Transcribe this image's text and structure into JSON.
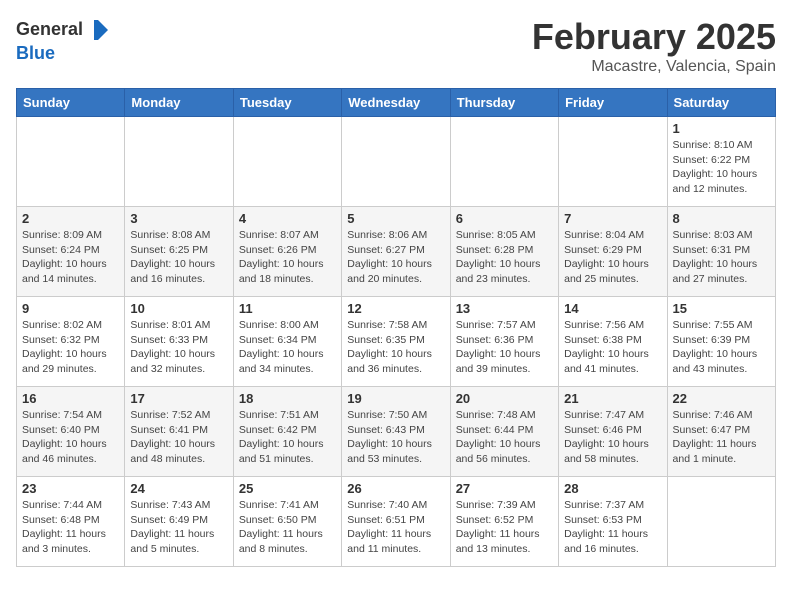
{
  "header": {
    "logo_line1": "General",
    "logo_line2": "Blue",
    "month": "February 2025",
    "location": "Macastre, Valencia, Spain"
  },
  "weekdays": [
    "Sunday",
    "Monday",
    "Tuesday",
    "Wednesday",
    "Thursday",
    "Friday",
    "Saturday"
  ],
  "weeks": [
    [
      {
        "day": "",
        "info": ""
      },
      {
        "day": "",
        "info": ""
      },
      {
        "day": "",
        "info": ""
      },
      {
        "day": "",
        "info": ""
      },
      {
        "day": "",
        "info": ""
      },
      {
        "day": "",
        "info": ""
      },
      {
        "day": "1",
        "info": "Sunrise: 8:10 AM\nSunset: 6:22 PM\nDaylight: 10 hours\nand 12 minutes."
      }
    ],
    [
      {
        "day": "2",
        "info": "Sunrise: 8:09 AM\nSunset: 6:24 PM\nDaylight: 10 hours\nand 14 minutes."
      },
      {
        "day": "3",
        "info": "Sunrise: 8:08 AM\nSunset: 6:25 PM\nDaylight: 10 hours\nand 16 minutes."
      },
      {
        "day": "4",
        "info": "Sunrise: 8:07 AM\nSunset: 6:26 PM\nDaylight: 10 hours\nand 18 minutes."
      },
      {
        "day": "5",
        "info": "Sunrise: 8:06 AM\nSunset: 6:27 PM\nDaylight: 10 hours\nand 20 minutes."
      },
      {
        "day": "6",
        "info": "Sunrise: 8:05 AM\nSunset: 6:28 PM\nDaylight: 10 hours\nand 23 minutes."
      },
      {
        "day": "7",
        "info": "Sunrise: 8:04 AM\nSunset: 6:29 PM\nDaylight: 10 hours\nand 25 minutes."
      },
      {
        "day": "8",
        "info": "Sunrise: 8:03 AM\nSunset: 6:31 PM\nDaylight: 10 hours\nand 27 minutes."
      }
    ],
    [
      {
        "day": "9",
        "info": "Sunrise: 8:02 AM\nSunset: 6:32 PM\nDaylight: 10 hours\nand 29 minutes."
      },
      {
        "day": "10",
        "info": "Sunrise: 8:01 AM\nSunset: 6:33 PM\nDaylight: 10 hours\nand 32 minutes."
      },
      {
        "day": "11",
        "info": "Sunrise: 8:00 AM\nSunset: 6:34 PM\nDaylight: 10 hours\nand 34 minutes."
      },
      {
        "day": "12",
        "info": "Sunrise: 7:58 AM\nSunset: 6:35 PM\nDaylight: 10 hours\nand 36 minutes."
      },
      {
        "day": "13",
        "info": "Sunrise: 7:57 AM\nSunset: 6:36 PM\nDaylight: 10 hours\nand 39 minutes."
      },
      {
        "day": "14",
        "info": "Sunrise: 7:56 AM\nSunset: 6:38 PM\nDaylight: 10 hours\nand 41 minutes."
      },
      {
        "day": "15",
        "info": "Sunrise: 7:55 AM\nSunset: 6:39 PM\nDaylight: 10 hours\nand 43 minutes."
      }
    ],
    [
      {
        "day": "16",
        "info": "Sunrise: 7:54 AM\nSunset: 6:40 PM\nDaylight: 10 hours\nand 46 minutes."
      },
      {
        "day": "17",
        "info": "Sunrise: 7:52 AM\nSunset: 6:41 PM\nDaylight: 10 hours\nand 48 minutes."
      },
      {
        "day": "18",
        "info": "Sunrise: 7:51 AM\nSunset: 6:42 PM\nDaylight: 10 hours\nand 51 minutes."
      },
      {
        "day": "19",
        "info": "Sunrise: 7:50 AM\nSunset: 6:43 PM\nDaylight: 10 hours\nand 53 minutes."
      },
      {
        "day": "20",
        "info": "Sunrise: 7:48 AM\nSunset: 6:44 PM\nDaylight: 10 hours\nand 56 minutes."
      },
      {
        "day": "21",
        "info": "Sunrise: 7:47 AM\nSunset: 6:46 PM\nDaylight: 10 hours\nand 58 minutes."
      },
      {
        "day": "22",
        "info": "Sunrise: 7:46 AM\nSunset: 6:47 PM\nDaylight: 11 hours\nand 1 minute."
      }
    ],
    [
      {
        "day": "23",
        "info": "Sunrise: 7:44 AM\nSunset: 6:48 PM\nDaylight: 11 hours\nand 3 minutes."
      },
      {
        "day": "24",
        "info": "Sunrise: 7:43 AM\nSunset: 6:49 PM\nDaylight: 11 hours\nand 5 minutes."
      },
      {
        "day": "25",
        "info": "Sunrise: 7:41 AM\nSunset: 6:50 PM\nDaylight: 11 hours\nand 8 minutes."
      },
      {
        "day": "26",
        "info": "Sunrise: 7:40 AM\nSunset: 6:51 PM\nDaylight: 11 hours\nand 11 minutes."
      },
      {
        "day": "27",
        "info": "Sunrise: 7:39 AM\nSunset: 6:52 PM\nDaylight: 11 hours\nand 13 minutes."
      },
      {
        "day": "28",
        "info": "Sunrise: 7:37 AM\nSunset: 6:53 PM\nDaylight: 11 hours\nand 16 minutes."
      },
      {
        "day": "",
        "info": ""
      }
    ]
  ]
}
